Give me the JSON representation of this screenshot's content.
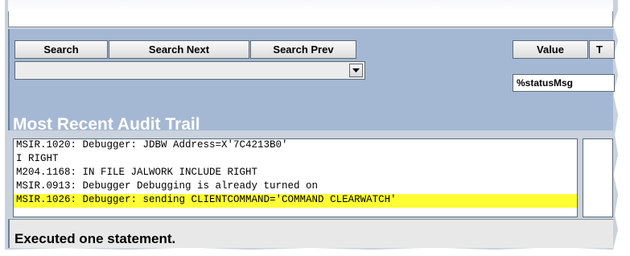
{
  "toolbar": {
    "search_label": "Search",
    "search_next_label": "Search Next",
    "search_prev_label": "Search Prev",
    "value_label": "Value",
    "partial_tab_label": "T",
    "dropdown_value": ""
  },
  "status_field": {
    "value": "%statusMsg"
  },
  "audit": {
    "title": "Most Recent Audit Trail",
    "lines": [
      "MSIR.1020: Debugger: JDBW Address=X'7C4213B0'",
      "I RIGHT",
      "M204.1168: IN FILE JALWORK INCLUDE RIGHT",
      "MSIR.0913: Debugger Debugging is already turned on",
      "MSIR.1026: Debugger: sending CLIENTCOMMAND='COMMAND CLEARWATCH'"
    ],
    "highlight_color": "#ffff33"
  },
  "status_bar": {
    "message": "Executed one statement."
  },
  "icons": {
    "dropdown": "chevron-down-icon"
  },
  "colors": {
    "panel_background": "#a5b8d3",
    "title_text": "#ffffff",
    "status_background": "#e8e8e8"
  }
}
